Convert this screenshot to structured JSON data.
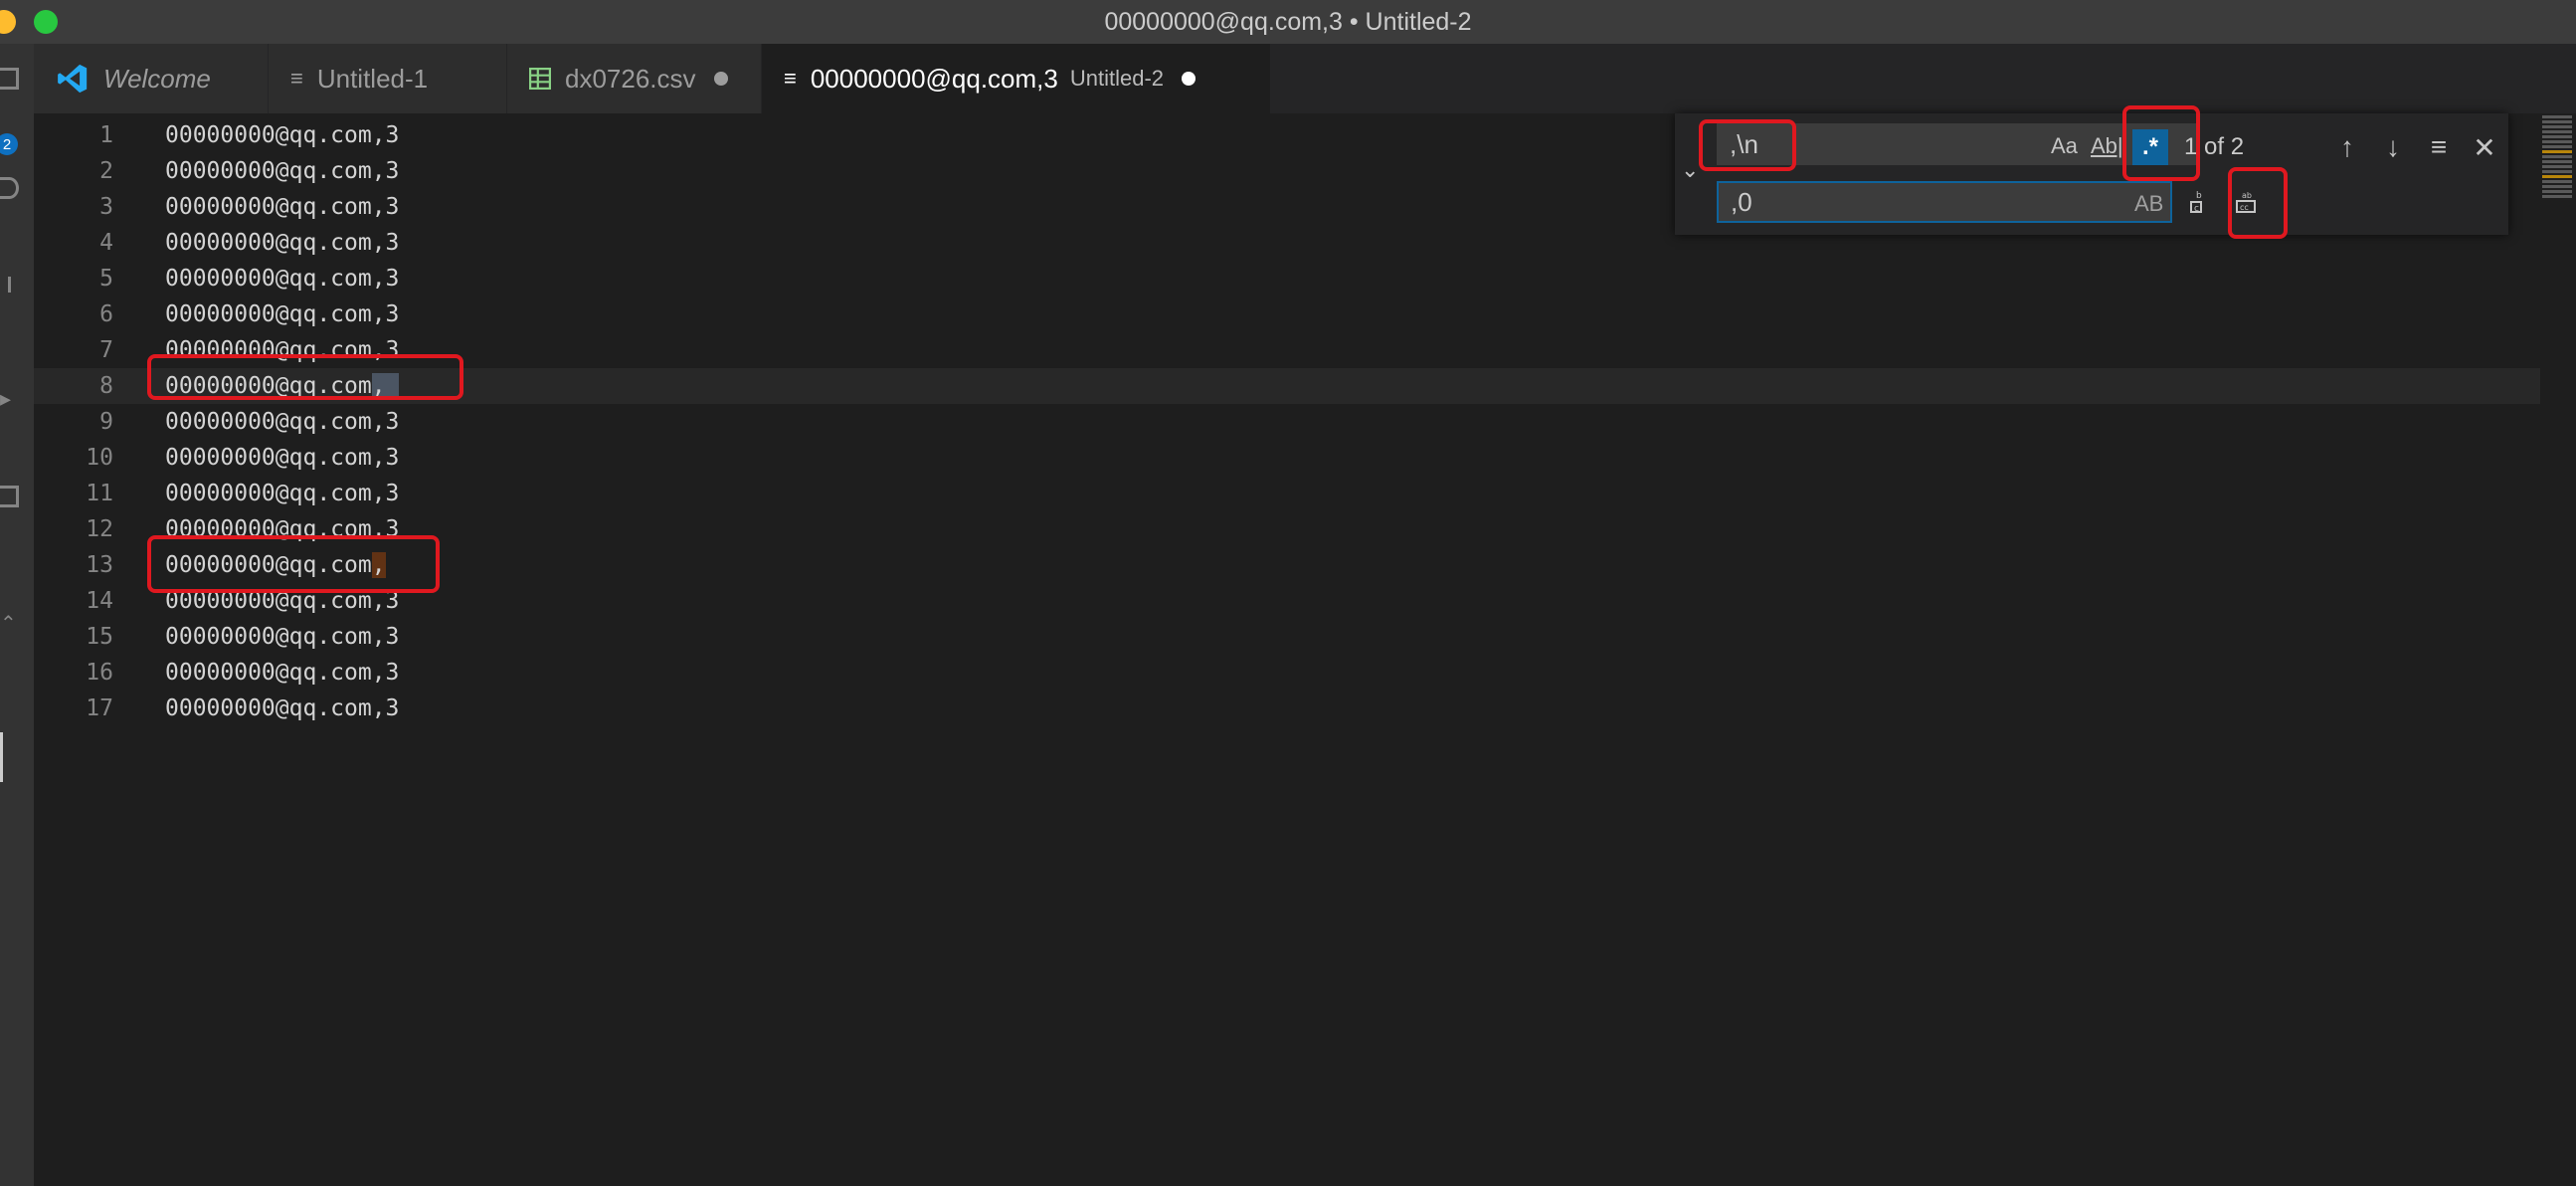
{
  "window": {
    "title": "00000000@qq.com,3 • Untitled-2"
  },
  "activity": {
    "badge": "2"
  },
  "tabs": [
    {
      "label": "Welcome",
      "icon": "vscode-icon"
    },
    {
      "label": "Untitled-1",
      "icon": "text-file-icon"
    },
    {
      "label": "dx0726.csv",
      "icon": "csv-file-icon",
      "dirty": true
    },
    {
      "label": "00000000@qq.com,3",
      "description": "Untitled-2",
      "icon": "text-file-icon",
      "dirty": true,
      "active": true
    }
  ],
  "editor": {
    "lines": [
      {
        "n": "1",
        "text": "00000000@qq.com,3"
      },
      {
        "n": "2",
        "text": "00000000@qq.com,3"
      },
      {
        "n": "3",
        "text": "00000000@qq.com,3"
      },
      {
        "n": "4",
        "text": "00000000@qq.com,3"
      },
      {
        "n": "5",
        "text": "00000000@qq.com,3"
      },
      {
        "n": "6",
        "text": "00000000@qq.com,3"
      },
      {
        "n": "7",
        "text": "00000000@qq.com,3"
      },
      {
        "n": "8",
        "text": "00000000@qq.com",
        "match": ",",
        "current": true
      },
      {
        "n": "9",
        "text": "00000000@qq.com,3"
      },
      {
        "n": "10",
        "text": "00000000@qq.com,3"
      },
      {
        "n": "11",
        "text": "00000000@qq.com,3"
      },
      {
        "n": "12",
        "text": "00000000@qq.com,3"
      },
      {
        "n": "13",
        "text": "00000000@qq.com",
        "match": ","
      },
      {
        "n": "14",
        "text": "00000000@qq.com,3"
      },
      {
        "n": "15",
        "text": "00000000@qq.com,3"
      },
      {
        "n": "16",
        "text": "00000000@qq.com,3"
      },
      {
        "n": "17",
        "text": "00000000@qq.com,3"
      }
    ]
  },
  "find": {
    "search_value": ",\\n",
    "replace_value": ",0",
    "match_case_label": "Aa",
    "whole_word_label": "Ab|",
    "regex_label": ".*",
    "preserve_case_label": "AB",
    "match_count": "1 of 2"
  },
  "colors": {
    "accent": "#0e639c",
    "annotation": "#e0181f",
    "badge": "#0e70c0"
  }
}
